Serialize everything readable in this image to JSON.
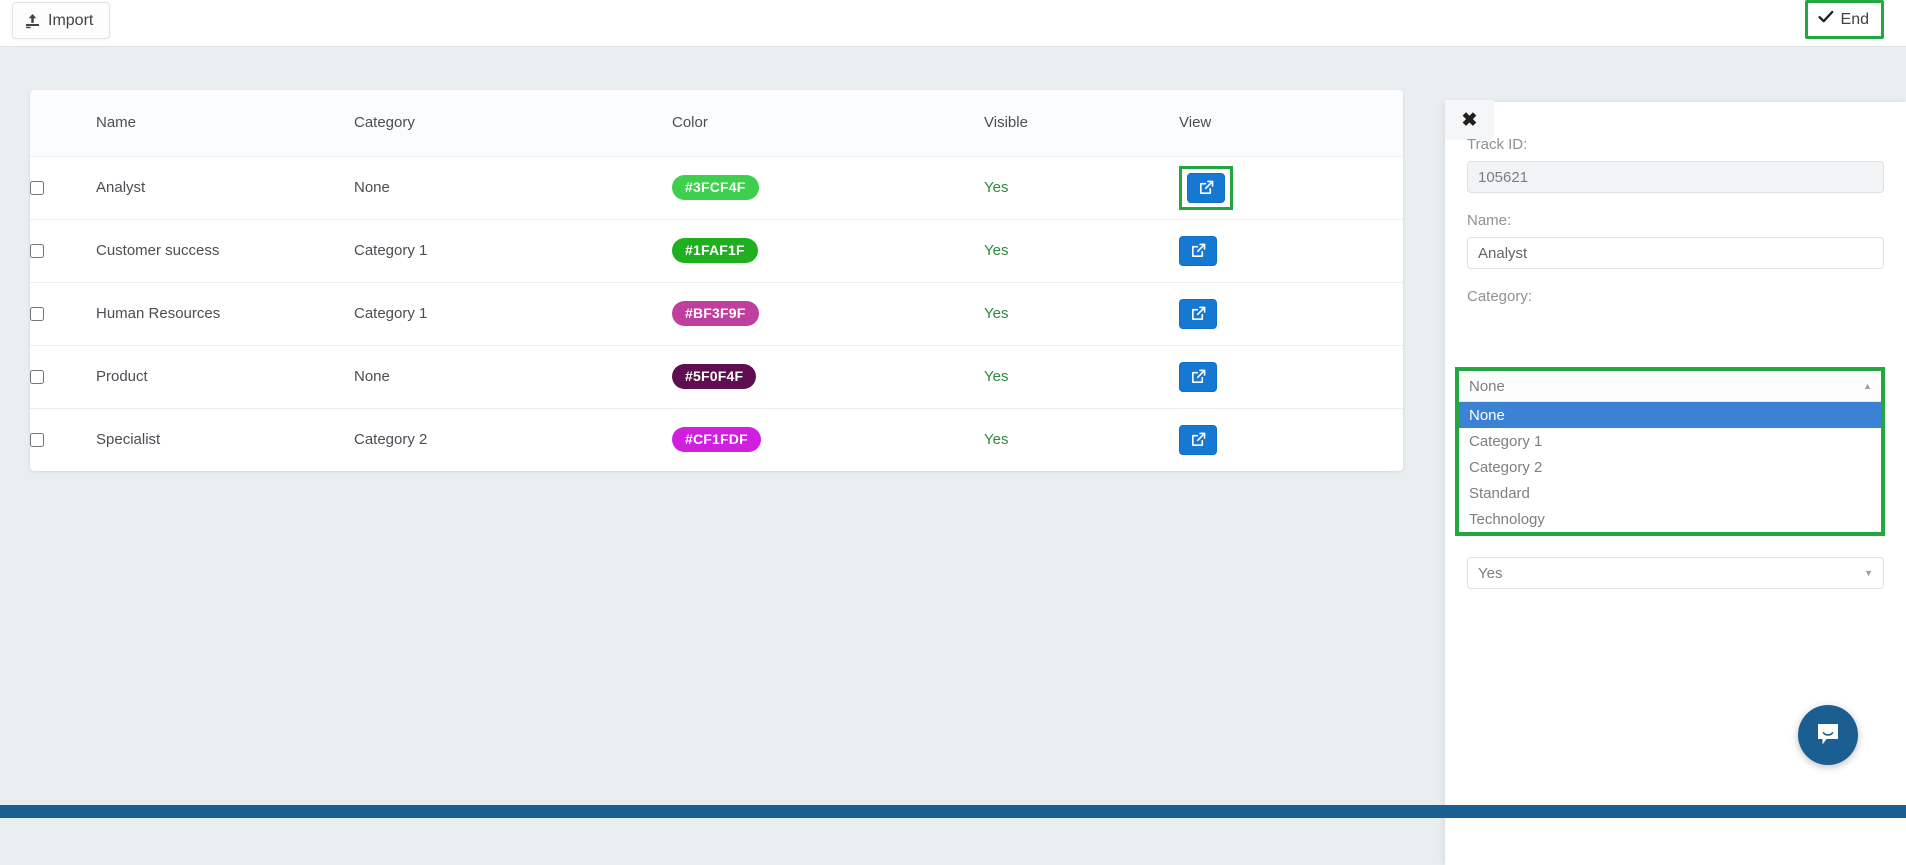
{
  "toolbar": {
    "import_label": "Import",
    "import_icon": "upload-icon",
    "end_label": "End",
    "end_icon": "check-icon",
    "end_highlight_color": "#22a83f"
  },
  "table": {
    "columns": [
      "Name",
      "Category",
      "Color",
      "Visible",
      "View"
    ],
    "rows": [
      {
        "name": "Analyst",
        "category": "None",
        "color": "#3FCF4F",
        "visible": "Yes",
        "view_icon": "external-link-icon",
        "highlighted": true
      },
      {
        "name": "Customer success",
        "category": "Category 1",
        "color": "#1FAF1F",
        "visible": "Yes",
        "view_icon": "external-link-icon",
        "highlighted": false
      },
      {
        "name": "Human Resources",
        "category": "Category 1",
        "color": "#BF3F9F",
        "visible": "Yes",
        "view_icon": "external-link-icon",
        "highlighted": false
      },
      {
        "name": "Product",
        "category": "None",
        "color": "#5F0F4F",
        "visible": "Yes",
        "view_icon": "external-link-icon",
        "highlighted": false
      },
      {
        "name": "Specialist",
        "category": "Category 2",
        "color": "#CF1FDF",
        "visible": "Yes",
        "view_icon": "external-link-icon",
        "highlighted": false
      }
    ]
  },
  "panel": {
    "close_label": "✖",
    "track_id_label": "Track ID:",
    "track_id_value": "105621",
    "name_label": "Name:",
    "name_value": "Analyst",
    "category_label": "Category:",
    "category_selected": "None",
    "category_options": [
      "None",
      "Category 1",
      "Category 2",
      "Standard",
      "Technology"
    ],
    "visible_selected": "Yes",
    "dropdown_highlight_color": "#22a83f",
    "dropdown_selected_bg": "#3b82d4"
  },
  "chat": {
    "icon": "chat-bubble-icon",
    "color": "#1b5e92"
  }
}
